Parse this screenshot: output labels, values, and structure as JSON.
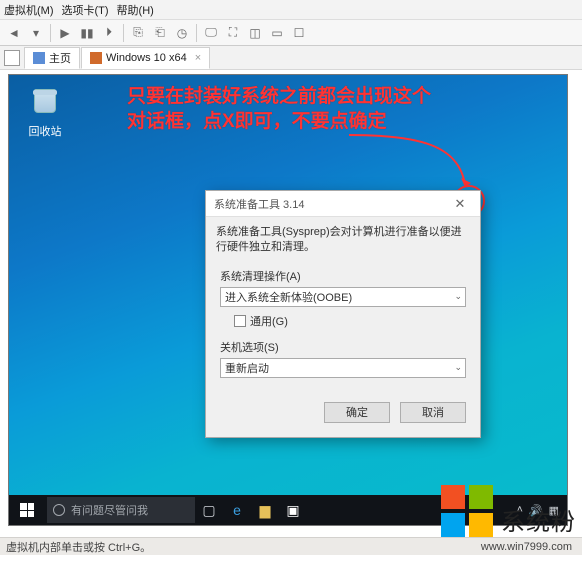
{
  "menubar": {
    "items": [
      "虚拟机(M)",
      "选项卡(T)",
      "帮助(H)"
    ]
  },
  "toolbar_icons": [
    "nav-back",
    "nav-sep",
    "power",
    "pause",
    "snapshot",
    "settings",
    "clock",
    "monitor",
    "fullscreen",
    "unity",
    "connect",
    "screenshot",
    "guest"
  ],
  "tabs": {
    "home": {
      "label": "主页"
    },
    "vm": {
      "label": "Windows 10 x64"
    }
  },
  "annotation": {
    "line1": "只要在封装好系统之前都会出现这个",
    "line2": "对话框，点X即可，不要点确定"
  },
  "desktop_icon": {
    "label": "回收站"
  },
  "dialog": {
    "title": "系统准备工具 3.14",
    "description": "系统准备工具(Sysprep)会对计算机进行准备以便进行硬件独立和清理。",
    "group1_label": "系统清理操作(A)",
    "group1_value": "进入系统全新体验(OOBE)",
    "generalize_label": "通用(G)",
    "group2_label": "关机选项(S)",
    "group2_value": "重新启动",
    "ok": "确定",
    "cancel": "取消"
  },
  "taskbar": {
    "search_placeholder": "有问题尽管问我"
  },
  "statusbar": {
    "text": "虚拟机内部单击或按 Ctrl+G。"
  },
  "branding": {
    "name": "系统粉",
    "url": "www.win7999.com"
  }
}
